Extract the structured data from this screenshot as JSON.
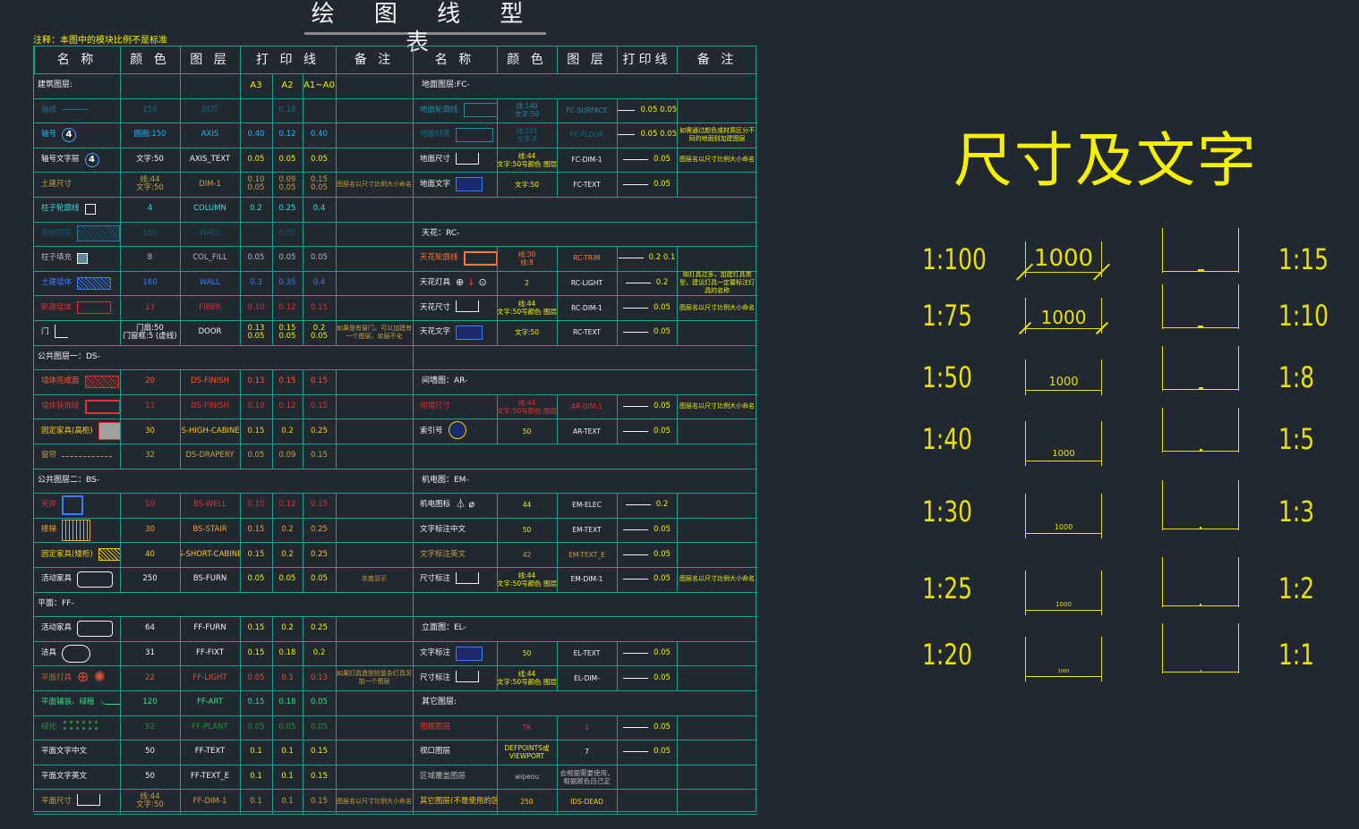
{
  "title": "绘 图 线 型 表",
  "note": "注释：本图中的模块比例不是标准",
  "headers": {
    "left": [
      "名  称",
      "颜 色",
      "图 层",
      "打 印 线",
      "备 注"
    ],
    "right": [
      "名 称",
      "颜 色",
      "图 层",
      "打印线",
      "备 注"
    ],
    "print_cols": [
      "A3",
      "A2",
      "A1~A0"
    ]
  },
  "left_rows": [
    {
      "section": "建筑图层:"
    },
    {
      "name": "轴线",
      "color": "150",
      "layer": "DOT",
      "p": [
        "",
        "0.18",
        ""
      ],
      "remark": "",
      "tc": "#1a6b86",
      "sym": "line"
    },
    {
      "name": "轴号",
      "color": "圆圈:150",
      "layer": "AXIS",
      "p": [
        "0.40",
        "0.12",
        "0.40"
      ],
      "remark": "",
      "tc": "#1ab6ff",
      "sym": "circle",
      "symtext": "4"
    },
    {
      "name": "轴号文字层",
      "color": "文字:50",
      "layer": "AXIS_TEXT",
      "p": [
        "0.05",
        "0.05",
        "0.05"
      ],
      "remark": "",
      "tc": "#f3f3f3",
      "sym": "circle",
      "symtext": "4"
    },
    {
      "name": "土建尺寸",
      "color": "线:44 文字:50",
      "layer": "DIM-1",
      "p": [
        "0.10 0.05",
        "0.09 0.05",
        "0.15 0.05"
      ],
      "remark": "图层名以尺寸比例大小命名",
      "tc": "#c8a040",
      "sym": ""
    },
    {
      "name": "柱子轮廓线",
      "color": "4",
      "layer": "COLUMN",
      "p": [
        "0.2",
        "0.25",
        "0.4"
      ],
      "remark": "",
      "tc": "#34e0e0",
      "sym": "square"
    },
    {
      "name": "原始图层",
      "color": "180",
      "layer": "WALL",
      "p": [
        "",
        "0.05",
        ""
      ],
      "remark": "",
      "tc": "#1a5470",
      "sym": "rect-blue"
    },
    {
      "name": "柱子填充",
      "color": "8",
      "layer": "COL_FILL",
      "p": [
        "0.05",
        "0.05",
        "0.05"
      ],
      "remark": "",
      "tc": "#b8b8b8",
      "sym": "square-fill"
    },
    {
      "name": "土建墙体",
      "color": "160",
      "layer": "WALL",
      "p": [
        "0.3",
        "0.35",
        "0.4"
      ],
      "remark": "",
      "tc": "#3a7cff",
      "sym": "rect-hatch-blue"
    },
    {
      "name": "新建墙体",
      "color": "13",
      "layer": "FIBER",
      "p": [
        "0.10",
        "0.12",
        "0.15"
      ],
      "remark": "",
      "tc": "#e03030",
      "sym": "rect-red"
    },
    {
      "name": "门",
      "color": "门扇:50 门窗框:5 (虚线)",
      "layer": "DOOR",
      "p": [
        "0.13 0.05",
        "0.15 0.05",
        "0.2 0.05"
      ],
      "remark": "如果是有窗门，可以加建有一个图层，如层不化",
      "tc": "#f3f3f3",
      "sym": "door"
    },
    {
      "section": "公共图层一：DS-"
    },
    {
      "name": "墙体完成面",
      "color": "20",
      "layer": "DS-FINISH",
      "p": [
        "0.13",
        "0.15",
        "0.15"
      ],
      "remark": "",
      "tc": "#ff5a2a",
      "sym": "rect-hatch-red"
    },
    {
      "name": "墙体装饰线",
      "color": "13",
      "layer": "DS-FINISH",
      "p": [
        "0.10",
        "0.12",
        "0.15"
      ],
      "remark": "",
      "tc": "#e03030",
      "sym": "rect-red2"
    },
    {
      "name": "固定家具(高柜)",
      "color": "30",
      "layer": "DS-HIGH-CABINET",
      "p": [
        "0.15",
        "0.2",
        "0.25"
      ],
      "remark": "",
      "tc": "#ffcc00",
      "sym": "cabinet"
    },
    {
      "name": "窗帘",
      "color": "32",
      "layer": "DS-DRAPERY",
      "p": [
        "0.05",
        "0.09",
        "0.15"
      ],
      "remark": "",
      "tc": "#c8a040",
      "sym": "curtain"
    },
    {
      "section": "公共图层二：BS-"
    },
    {
      "name": "天井",
      "color": "10",
      "layer": "BS-WELL",
      "p": [
        "0.10",
        "0.12",
        "0.15"
      ],
      "remark": "",
      "tc": "#e03030",
      "sym": "rect-blue-sq"
    },
    {
      "name": "楼梯",
      "color": "30",
      "layer": "BS-STAIR",
      "p": [
        "0.15",
        "0.2",
        "0.25"
      ],
      "remark": "",
      "tc": "#f3a030",
      "sym": "stair"
    },
    {
      "name": "固定家具(矮柜)",
      "color": "40",
      "layer": "BS-SHORT-CABINET",
      "p": [
        "0.15",
        "0.2",
        "0.25"
      ],
      "remark": "",
      "tc": "#ffcc00",
      "sym": "rect-yellow"
    },
    {
      "name": "活动家具",
      "color": "250",
      "layer": "BS-FURN",
      "p": [
        "0.05",
        "0.05",
        "0.05"
      ],
      "remark": "灰度显示",
      "tc": "#f3f3f3",
      "sym": "sofa"
    },
    {
      "section": "平面：FF-"
    },
    {
      "name": "活动家具",
      "color": "64",
      "layer": "FF-FURN",
      "p": [
        "0.15",
        "0.2",
        "0.25"
      ],
      "remark": "",
      "tc": "#f3f3f3",
      "sym": "sofa2"
    },
    {
      "name": "洁具",
      "color": "31",
      "layer": "FF-FIXT",
      "p": [
        "0.15",
        "0.18",
        "0.2"
      ],
      "remark": "",
      "tc": "#f3f3f3",
      "sym": "toilet"
    },
    {
      "name": "平面灯具",
      "color": "22",
      "layer": "FF-LIGHT",
      "p": [
        "0.05",
        "0.1",
        "0.13"
      ],
      "remark": "如果灯具造型较复杂灯具另加一个图层",
      "tc": "#e05030",
      "sym": "lamp"
    },
    {
      "name": "平面铺装、绿植",
      "color": "120",
      "layer": "FF-ART",
      "p": [
        "0.15",
        "0.18",
        "0.05"
      ],
      "remark": "",
      "tc": "#34e08a",
      "sym": "line-curve"
    },
    {
      "name": "绿化",
      "color": "92",
      "layer": "FF-PLANT",
      "p": [
        "0.05",
        "0.05",
        "0.05"
      ],
      "remark": "",
      "tc": "#2c8a3a",
      "sym": "plant"
    },
    {
      "name": "平面文字中文",
      "color": "50",
      "layer": "FF-TEXT",
      "p": [
        "0.1",
        "0.1",
        "0.15"
      ],
      "remark": "",
      "tc": "#f3f3f3",
      "sym": ""
    },
    {
      "name": "平面文字英文",
      "color": "50",
      "layer": "FF-TEXT_E",
      "p": [
        "0.1",
        "0.1",
        "0.15"
      ],
      "remark": "",
      "tc": "#f3f3f3",
      "sym": ""
    },
    {
      "name": "平面尺寸",
      "color": "线:44 文字:50",
      "layer": "FF-DIM-1",
      "p": [
        "0.1",
        "0.1",
        "0.15"
      ],
      "remark": "图层名以尺寸比例大小命名",
      "tc": "#c8a040",
      "sym": "dimbox"
    }
  ],
  "right_rows": [
    {
      "section": "地面图层:FC-"
    },
    {
      "name": "地面轮廓线",
      "color": "线:140 文字:50",
      "layer": "FC-SURFACE",
      "print": "0.05 0.05",
      "remark": "",
      "tc": "#2a8aa0",
      "sym": "floor"
    },
    {
      "name": "地面材质",
      "color": "线:101 文字:8",
      "layer": "FC-FLOOR",
      "print": "0.05 0.05",
      "remark": "如需通过颜色或材质区分不同的地面则加建图层",
      "tc": "#1a6b86",
      "sym": "floor2"
    },
    {
      "name": "地面尺寸",
      "color": "线:44 文字:50号颜色 图层",
      "layer": "FC-DIM-1",
      "print": "0.05",
      "remark": "图层名以尺寸比例大小命名",
      "tc": "#f3f3f3",
      "sym": "dimbox"
    },
    {
      "name": "地面文字",
      "color": "文字:50",
      "layer": "FC-TEXT",
      "print": "0.05",
      "remark": "",
      "tc": "#f3f3f3",
      "sym": "textbox"
    },
    {
      "section": ""
    },
    {
      "section": "天花：RC-"
    },
    {
      "name": "天花轮廓线",
      "color": "线:30 线:8",
      "layer": "RC-TRIM",
      "print": "0.2 0.1",
      "remark": "",
      "tc": "#ff7a3a",
      "sym": "ceil"
    },
    {
      "name": "天花灯具",
      "color": "2",
      "layer": "RC-LIGHT",
      "print": "0.2",
      "remark": "如灯具过多，加建灯具类型，建议灯具一定要标注灯具的名称",
      "tc": "#f3f3f3",
      "sym": "ceil-lamp"
    },
    {
      "name": "天花尺寸",
      "color": "线:44 文字:50号颜色 图层",
      "layer": "RC-DIM-1",
      "print": "0.05",
      "remark": "图层名以尺寸比例大小命名",
      "tc": "#f3f3f3",
      "sym": "dimbox"
    },
    {
      "name": "天花文字",
      "color": "文字:50",
      "layer": "RC-TEXT",
      "print": "0.05",
      "remark": "",
      "tc": "#f3f3f3",
      "sym": "textbox"
    },
    {
      "section": ""
    },
    {
      "section": "间墙图：AR-"
    },
    {
      "name": "间墙尺寸",
      "color": "线:44 文字:50号颜色 图层",
      "layer": "AR-DIM-1",
      "print": "0.05",
      "remark": "图层名以尺寸比例大小命名",
      "tc": "#e03030",
      "sym": ""
    },
    {
      "name": "索引号",
      "color": "50",
      "layer": "AR-TEXT",
      "print": "0.05",
      "remark": "",
      "tc": "#f3f3f3",
      "sym": "index"
    },
    {
      "section": ""
    },
    {
      "section": "机电图：EM-"
    },
    {
      "name": "机电图标",
      "color": "44",
      "layer": "EM-ELEC",
      "print": "0.2",
      "remark": "",
      "tc": "#f3f3f3",
      "sym": "elec"
    },
    {
      "name": "文字标注中文",
      "color": "50",
      "layer": "EM-TEXT",
      "print": "0.05",
      "remark": "",
      "tc": "#f3f3f3",
      "sym": ""
    },
    {
      "name": "文字标注英文",
      "color": "42",
      "layer": "EM-TEXT_E",
      "print": "0.05",
      "remark": "",
      "tc": "#c8a040",
      "sym": ""
    },
    {
      "name": "尺寸标注",
      "color": "线:44 文字:50号颜色 图层",
      "layer": "EM-DIM-1",
      "print": "0.05",
      "remark": "图层名以尺寸比例大小命名",
      "tc": "#f3f3f3",
      "sym": "dimbox"
    },
    {
      "section": ""
    },
    {
      "section": "立面图：EL-"
    },
    {
      "name": "文字标注",
      "color": "50",
      "layer": "EL-TEXT",
      "print": "0.05",
      "remark": "",
      "tc": "#f3f3f3",
      "sym": "textbox"
    },
    {
      "name": "尺寸标注",
      "color": "线:44 文字:50号颜色 图层",
      "layer": "EL-DIM-",
      "print": "0.05",
      "remark": "",
      "tc": "#f3f3f3",
      "sym": "dimbox"
    },
    {
      "section": "其它图层:"
    },
    {
      "name": "图框图层",
      "color": "TK",
      "layer": "1",
      "print": "0.05",
      "remark": "",
      "tc": "#ff2a2a",
      "sym": ""
    },
    {
      "name": "视口图层",
      "color": "DEFPOINTS或 VIEWPORT",
      "layer": "7",
      "print": "0.05",
      "remark": "",
      "tc": "#f3f3f3",
      "sym": ""
    },
    {
      "name": "区域覆盖图层",
      "color": "wipeou",
      "layer": "会根据需要使用，根据颜色自己定",
      "print": "",
      "remark": "",
      "tc": "#b8b8b8",
      "sym": ""
    },
    {
      "name": "其它图层(不是使用的区域)",
      "color": "250",
      "layer": "IDS-DEAD",
      "print": "",
      "remark": "",
      "tc": "#ffcc00",
      "sym": ""
    }
  ],
  "right_panel": {
    "heading": "尺寸及文字",
    "left_scales": [
      "1:100",
      "1:75",
      "1:50",
      "1:40",
      "1:30",
      "1:25",
      "1:20"
    ],
    "right_scales": [
      "1:15",
      "1:10",
      "1:8",
      "1:5",
      "1:3",
      "1:2",
      "1:1"
    ],
    "dim_value": "1000"
  },
  "colors": {
    "background": "#212830",
    "grid": "#1aa08f",
    "yellow": "#e9e200",
    "text": "#f3f3f3"
  }
}
